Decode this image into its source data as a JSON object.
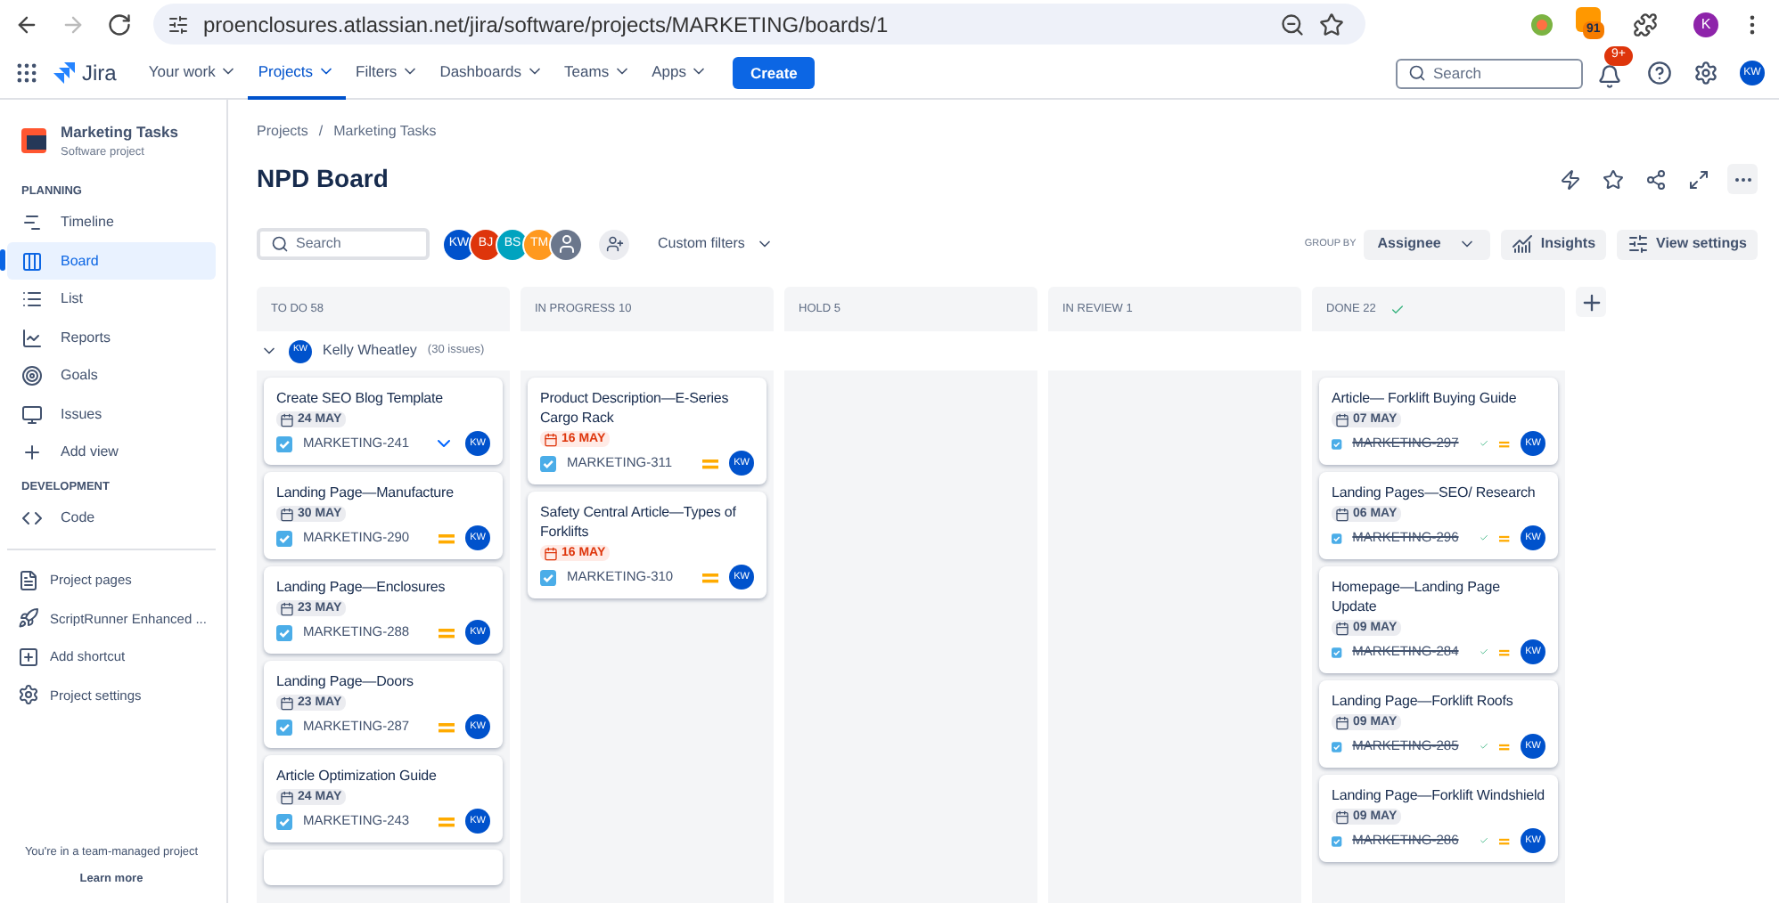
{
  "browser": {
    "url": "proenclosures.atlassian.net/jira/software/projects/MARKETING/boards/1",
    "extension_badge": "91",
    "profile": "K"
  },
  "nav": {
    "product": "Jira",
    "items": [
      {
        "label": "Your work",
        "selected": false
      },
      {
        "label": "Projects",
        "selected": true
      },
      {
        "label": "Filters",
        "selected": false
      },
      {
        "label": "Dashboards",
        "selected": false
      },
      {
        "label": "Teams",
        "selected": false
      },
      {
        "label": "Apps",
        "selected": false
      }
    ],
    "create": "Create",
    "search": {
      "placeholder": "Search"
    },
    "notifications": "9+",
    "user": "KW"
  },
  "sidebar": {
    "project": "Marketing Tasks",
    "project_type": "Software project",
    "sections": [
      {
        "heading": "PLANNING",
        "items": [
          {
            "label": "Timeline",
            "selected": false
          },
          {
            "label": "Board",
            "selected": true
          },
          {
            "label": "List",
            "selected": false
          },
          {
            "label": "Reports",
            "selected": false
          },
          {
            "label": "Goals",
            "selected": false
          },
          {
            "label": "Issues",
            "selected": false
          },
          {
            "label": "Add view",
            "selected": false
          }
        ]
      },
      {
        "heading": "DEVELOPMENT",
        "items": [
          {
            "label": "Code",
            "selected": false
          }
        ]
      }
    ],
    "extra_items": [
      {
        "label": "Project pages"
      },
      {
        "label": "ScriptRunner Enhanced ..."
      },
      {
        "label": "Add shortcut"
      },
      {
        "label": "Project settings"
      }
    ],
    "footer": "You're in a team-managed project",
    "footer_link": "Learn more"
  },
  "breadcrumbs": {
    "items": [
      "Projects",
      "Marketing Tasks"
    ],
    "separator": "/"
  },
  "title": "NPD Board",
  "toolbar": {
    "search": {
      "placeholder": "Search"
    },
    "avatars": [
      {
        "initials": "KW",
        "color": "#0052cc"
      },
      {
        "initials": "BJ",
        "color": "#de350b"
      },
      {
        "initials": "BS",
        "color": "#00a3bf"
      },
      {
        "initials": "TM",
        "color": "#ff991f"
      }
    ],
    "custom_filters": "Custom filters",
    "group_by_label": "GROUP BY",
    "group_by": "Assignee",
    "insights": "Insights",
    "view_settings": "View settings"
  },
  "swimlane": {
    "initials": "KW",
    "name": "Kelly Wheatley",
    "count": "(30 issues)",
    "expanded": true
  },
  "columns": [
    {
      "title": "TO DO 58",
      "done": false,
      "cards": [
        {
          "title": "Create SEO Blog Template",
          "due": "24 MAY",
          "overdue": false,
          "key": "MARKETING-241",
          "done": false,
          "kind": "low",
          "assignee": "KW"
        },
        {
          "title": "Landing Page—Manufacture",
          "due": "30 MAY",
          "overdue": false,
          "key": "MARKETING-290",
          "done": false,
          "kind": "medium",
          "assignee": "KW"
        },
        {
          "title": "Landing Page—Enclosures",
          "due": "23 MAY",
          "overdue": false,
          "key": "MARKETING-288",
          "done": false,
          "kind": "medium",
          "assignee": "KW"
        },
        {
          "title": "Landing Page—Doors",
          "due": "23 MAY",
          "overdue": false,
          "key": "MARKETING-287",
          "done": false,
          "kind": "medium",
          "assignee": "KW"
        },
        {
          "title": "Article Optimization Guide",
          "due": "24 MAY",
          "overdue": false,
          "key": "MARKETING-243",
          "done": false,
          "kind": "medium",
          "assignee": "KW"
        }
      ]
    },
    {
      "title": "IN PROGRESS 10",
      "done": false,
      "cards": [
        {
          "title": "Product Description—E-Series Cargo Rack",
          "due": "16 MAY",
          "overdue": true,
          "key": "MARKETING-311",
          "done": false,
          "kind": "medium",
          "assignee": "KW"
        },
        {
          "title": "Safety Central Article—Types of Forklifts",
          "due": "16 MAY",
          "overdue": true,
          "key": "MARKETING-310",
          "done": false,
          "kind": "medium",
          "assignee": "KW"
        }
      ]
    },
    {
      "title": "HOLD 5",
      "done": false
    },
    {
      "title": "IN REVIEW 1",
      "done": false
    },
    {
      "title": "DONE 22",
      "done": true,
      "cards": [
        {
          "title": "Article— Forklift Buying Guide",
          "due": "07 MAY",
          "overdue": false,
          "key": "MARKETING-297",
          "done": true,
          "kind": "medium",
          "assignee": "KW"
        },
        {
          "title": "Landing Pages—SEO/ Research",
          "due": "06 MAY",
          "overdue": false,
          "key": "MARKETING-296",
          "done": true,
          "kind": "medium",
          "assignee": "KW"
        },
        {
          "title": "Homepage—Landing Page Update",
          "due": "09 MAY",
          "overdue": false,
          "key": "MARKETING-284",
          "done": true,
          "kind": "medium",
          "assignee": "KW"
        },
        {
          "title": "Landing Page—Forklift Roofs",
          "due": "09 MAY",
          "overdue": false,
          "key": "MARKETING-285",
          "done": true,
          "kind": "medium",
          "assignee": "KW"
        },
        {
          "title": "Landing Page—Forklift Windshield",
          "due": "09 MAY",
          "overdue": false,
          "key": "MARKETING-286",
          "done": true,
          "kind": "medium",
          "assignee": "KW"
        }
      ]
    }
  ]
}
